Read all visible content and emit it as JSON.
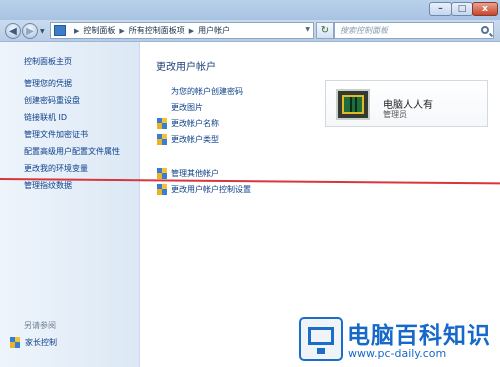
{
  "window": {
    "controls": {
      "minimize": "–",
      "maximize": "□",
      "close": "x"
    }
  },
  "address": {
    "crumbs": [
      "控制面板",
      "所有控制面板项",
      "用户帐户"
    ],
    "search_placeholder": "搜索控制面板"
  },
  "sidebar": {
    "home": "控制面板主页",
    "items": [
      "管理您的凭据",
      "创建密码重设盘",
      "链接联机 ID",
      "管理文件加密证书",
      "配置高级用户配置文件属性",
      "更改我的环境变量",
      "管理指纹数据"
    ],
    "see_also": "另请参阅",
    "family": "家长控制"
  },
  "main": {
    "title": "更改用户帐户",
    "options": [
      "为您的帐户创建密码",
      "更改图片",
      "更改帐户名称",
      "更改帐户类型",
      "管理其他帐户",
      "更改用户帐户控制设置"
    ]
  },
  "account": {
    "name": "电脑人人有",
    "role": "管理员"
  },
  "watermark": {
    "title": "电脑百科知识",
    "url": "www.pc-daily.com"
  },
  "colors": {
    "link": "#0b3f8a",
    "accent_line": "#d8363a",
    "watermark": "#1769c9"
  }
}
